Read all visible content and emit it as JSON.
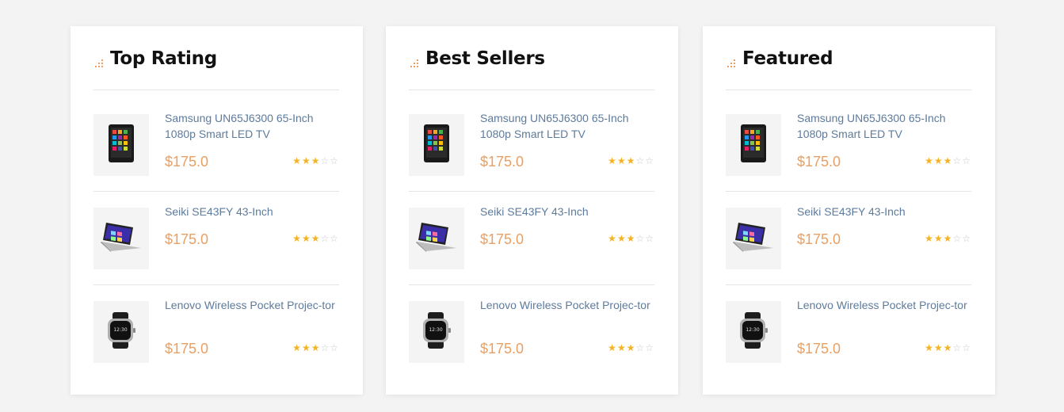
{
  "colors": {
    "accent": "#e8a064",
    "link": "#5d7b9d",
    "star": "#f4b324",
    "star_empty": "#c9c9c9"
  },
  "panels": [
    {
      "title": "Top Rating",
      "products": [
        {
          "name": "Samsung UN65J6300 65-Inch 1080p Smart LED TV",
          "price": "$175.0",
          "rating": 3,
          "max_rating": 5,
          "image": "tablet-icon"
        },
        {
          "name": "Seiki SE43FY 43-Inch",
          "price": "$175.0",
          "rating": 3,
          "max_rating": 5,
          "image": "laptop-icon"
        },
        {
          "name": "Lenovo Wireless Pocket Projec-tor",
          "price": "$175.0",
          "rating": 3,
          "max_rating": 5,
          "image": "smartwatch-icon"
        }
      ]
    },
    {
      "title": "Best Sellers",
      "products": [
        {
          "name": "Samsung UN65J6300 65-Inch 1080p Smart LED TV",
          "price": "$175.0",
          "rating": 3,
          "max_rating": 5,
          "image": "tablet-icon"
        },
        {
          "name": "Seiki SE43FY 43-Inch",
          "price": "$175.0",
          "rating": 3,
          "max_rating": 5,
          "image": "laptop-icon"
        },
        {
          "name": "Lenovo Wireless Pocket Projec-tor",
          "price": "$175.0",
          "rating": 3,
          "max_rating": 5,
          "image": "smartwatch-icon"
        }
      ]
    },
    {
      "title": "Featured",
      "products": [
        {
          "name": "Samsung UN65J6300 65-Inch 1080p Smart LED TV",
          "price": "$175.0",
          "rating": 3,
          "max_rating": 5,
          "image": "tablet-icon"
        },
        {
          "name": "Seiki SE43FY 43-Inch",
          "price": "$175.0",
          "rating": 3,
          "max_rating": 5,
          "image": "laptop-icon"
        },
        {
          "name": "Lenovo Wireless Pocket Projec-tor",
          "price": "$175.0",
          "rating": 3,
          "max_rating": 5,
          "image": "smartwatch-icon"
        }
      ]
    }
  ]
}
